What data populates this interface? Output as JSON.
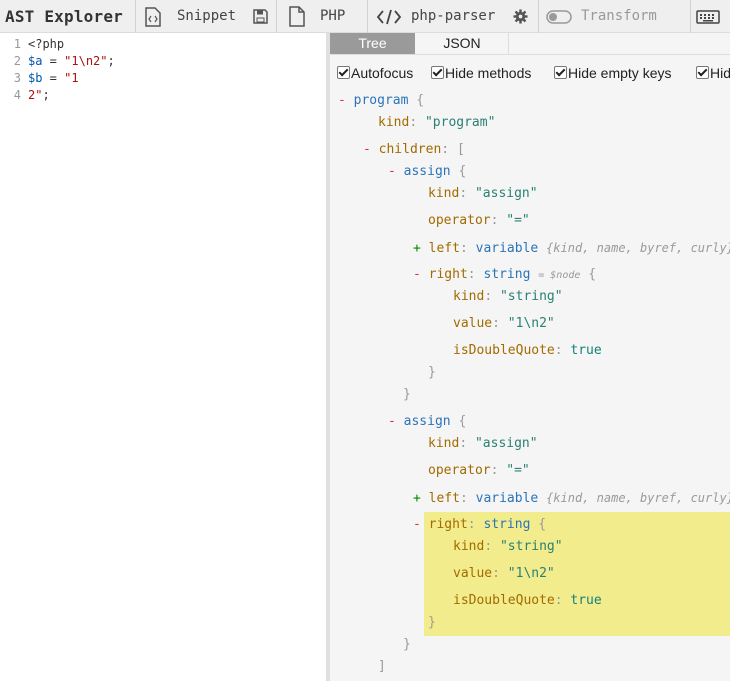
{
  "app": {
    "title": "AST Explorer",
    "snippet_label": "Snippet",
    "language_label": "PHP",
    "parser_label": "php-parser",
    "transform_label": "Transform"
  },
  "editor": {
    "lines": [
      {
        "num": "1",
        "parts": [
          {
            "t": "<?php",
            "c": "def"
          }
        ]
      },
      {
        "num": "2",
        "parts": [
          {
            "t": "$a",
            "c": "var"
          },
          {
            "t": " = ",
            "c": "op"
          },
          {
            "t": "\"1\\n2\"",
            "c": "str"
          },
          {
            "t": ";",
            "c": "op"
          }
        ]
      },
      {
        "num": "3",
        "parts": [
          {
            "t": "$b",
            "c": "var"
          },
          {
            "t": " = ",
            "c": "op"
          },
          {
            "t": "\"1",
            "c": "str"
          }
        ]
      },
      {
        "num": "4",
        "parts": [
          {
            "t": "2\"",
            "c": "str"
          },
          {
            "t": ";",
            "c": "op"
          }
        ]
      }
    ]
  },
  "tabs": {
    "tree": "Tree",
    "json": "JSON"
  },
  "options": [
    {
      "label": "Autofocus",
      "checked": true
    },
    {
      "label": "Hide methods",
      "checked": true
    },
    {
      "label": "Hide empty keys",
      "checked": true
    },
    {
      "label": "Hid",
      "checked": true
    }
  ],
  "tree": {
    "program": {
      "toggle": "-",
      "key": "program",
      "open": "{"
    },
    "program_kind": {
      "key": "kind",
      "value": "\"program\""
    },
    "children": {
      "toggle": "-",
      "key": "children",
      "open": "["
    },
    "assign1": {
      "toggle": "-",
      "key": "assign",
      "open": "{"
    },
    "a1_kind": {
      "key": "kind",
      "value": "\"assign\""
    },
    "a1_operator": {
      "key": "operator",
      "value": "\"=\""
    },
    "a1_left": {
      "toggle": "+",
      "key": "left",
      "type": "variable",
      "summary": "{kind, name, byref, curly}"
    },
    "a1_right": {
      "toggle": "-",
      "key": "right",
      "type": "string",
      "annotation": "= $node",
      "open": "{"
    },
    "a1_r_kind": {
      "key": "kind",
      "value": "\"string\""
    },
    "a1_r_value": {
      "key": "value",
      "value": "\"1\\n2\""
    },
    "a1_r_isdq": {
      "key": "isDoubleQuote",
      "value": "true"
    },
    "a1_r_close": "}",
    "a1_close": "}",
    "assign2": {
      "toggle": "-",
      "key": "assign",
      "open": "{"
    },
    "a2_kind": {
      "key": "kind",
      "value": "\"assign\""
    },
    "a2_operator": {
      "key": "operator",
      "value": "\"=\""
    },
    "a2_left": {
      "toggle": "+",
      "key": "left",
      "type": "variable",
      "summary": "{kind, name, byref, curly}"
    },
    "a2_right": {
      "toggle": "-",
      "key": "right",
      "type": "string",
      "open": "{"
    },
    "a2_r_kind": {
      "key": "kind",
      "value": "\"string\""
    },
    "a2_r_value": {
      "key": "value",
      "value": "\"1\\n2\""
    },
    "a2_r_isdq": {
      "key": "isDoubleQuote",
      "value": "true"
    },
    "a2_r_close": "}",
    "a2_close": "}",
    "children_close": "]"
  },
  "colors": {
    "toolbar_bg": "#efefef",
    "active_tab": "#9a9a9a",
    "highlight": "#f3ec8d",
    "key": "#a26b00",
    "string": "#2a8073",
    "type": "#2b74b8"
  }
}
